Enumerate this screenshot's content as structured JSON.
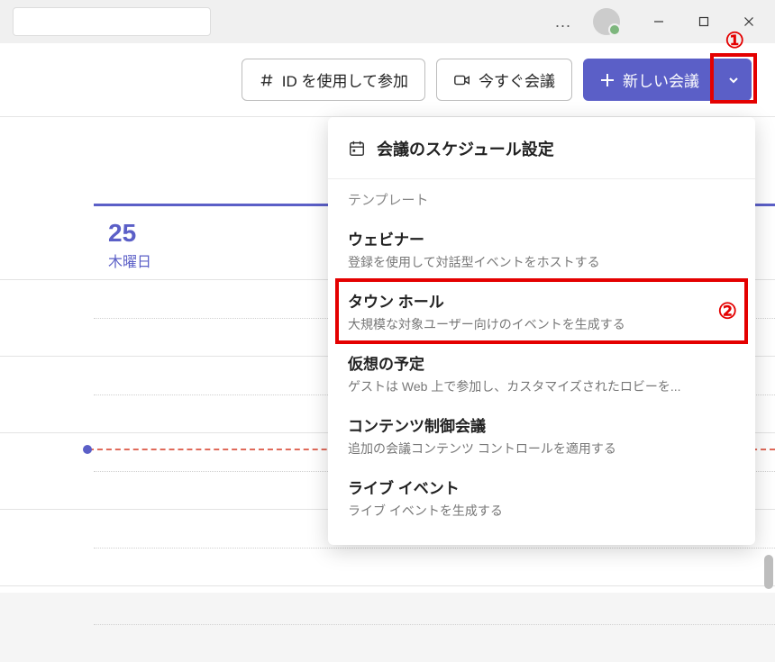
{
  "window": {
    "minimize_tooltip": "最小化",
    "maximize_tooltip": "最大化",
    "close_tooltip": "閉じる",
    "more_tooltip": "..."
  },
  "toolbar": {
    "join_by_id_label": "ID を使用して参加",
    "meet_now_label": "今すぐ会議",
    "new_meeting_label": "新しい会議"
  },
  "annotations": {
    "one": "①",
    "two": "②"
  },
  "calendar": {
    "date_number": "25",
    "day_name": "木曜日"
  },
  "dropdown": {
    "schedule_label": "会議のスケジュール設定",
    "section_label": "テンプレート",
    "items": [
      {
        "title": "ウェビナー",
        "desc": "登録を使用して対話型イベントをホストする"
      },
      {
        "title": "タウン ホール",
        "desc": "大規模な対象ユーザー向けのイベントを生成する"
      },
      {
        "title": "仮想の予定",
        "desc": "ゲストは Web 上で参加し、カスタマイズされたロビーを..."
      },
      {
        "title": "コンテンツ制御会議",
        "desc": "追加の会議コンテンツ コントロールを適用する"
      },
      {
        "title": "ライブ イベント",
        "desc": "ライブ イベントを生成する"
      }
    ]
  },
  "colors": {
    "accent": "#5b5fc7",
    "annotation": "#e40000"
  }
}
